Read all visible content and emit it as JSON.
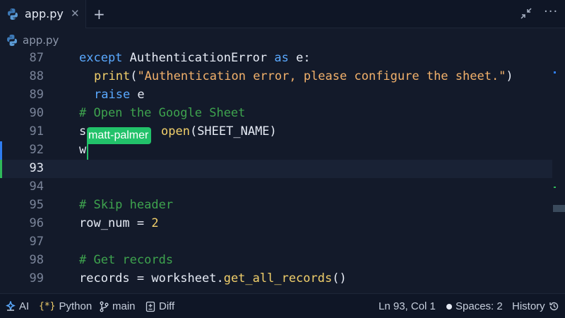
{
  "tabs": [
    {
      "label": "app.py",
      "icon": "python-icon",
      "active": true
    }
  ],
  "tab_actions": {
    "close": "✕",
    "new": "+",
    "more": "···"
  },
  "breadcrumb": {
    "file": "app.py"
  },
  "editor": {
    "current_line": 93,
    "lines": [
      {
        "num": "87"
      },
      {
        "num": "88"
      },
      {
        "num": "89"
      },
      {
        "num": "90"
      },
      {
        "num": "91"
      },
      {
        "num": "92"
      },
      {
        "num": "93"
      },
      {
        "num": "94"
      },
      {
        "num": "95"
      },
      {
        "num": "96"
      },
      {
        "num": "97"
      },
      {
        "num": "98"
      },
      {
        "num": "99"
      }
    ],
    "tokens": {
      "l87_kw1": "except",
      "l87_cls": " AuthenticationError ",
      "l87_kw2": "as",
      "l87_tail": " e:",
      "l88_fn": "print",
      "l88_p1": "(",
      "l88_str": "\"Authentication error, please configure the sheet.\"",
      "l88_p2": ")",
      "l89_kw": "raise",
      "l89_tail": " e",
      "l90_cm": "# Open the Google Sheet",
      "l91_a": "s",
      "l91_fn": "open",
      "l91_tail": "(SHEET_NAME)",
      "l92_a": "w",
      "l95_cm": "# Skip header",
      "l96_a": "row_num = ",
      "l96_num": "2",
      "l98_cm": "# Get records",
      "l99_a": "records = worksheet.",
      "l99_fn": "get_all_records",
      "l99_tail": "()"
    },
    "collaborator": {
      "name": "matt-palmer",
      "color": "#22c26a"
    }
  },
  "status_bar": {
    "ai": "AI",
    "language": "Python",
    "branch": "main",
    "diff": "Diff",
    "cursor": "Ln 93, Col 1",
    "spaces": "Spaces: 2",
    "history": "History"
  },
  "colors": {
    "keyword": "#5aa9ff",
    "function": "#f2d06b",
    "string": "#f2b16b",
    "comment": "#3ea34e",
    "accent_green": "#22c26a",
    "accent_blue": "#2f7df0"
  }
}
